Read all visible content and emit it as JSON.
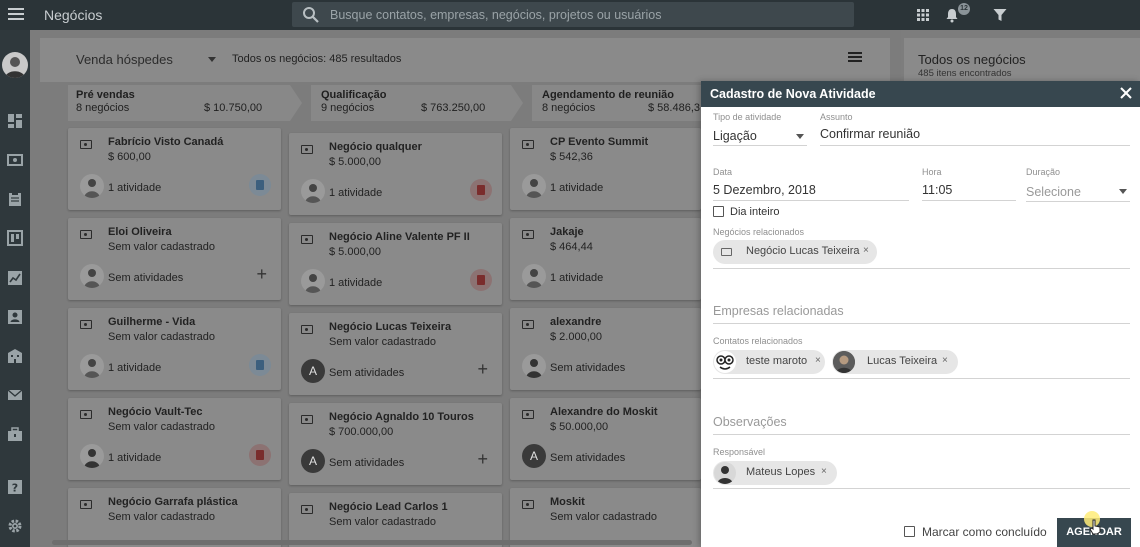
{
  "topbar": {
    "app_title": "Negócios",
    "search_placeholder": "Busque contatos, empresas, negócios, projetos ou usuários",
    "notification_count": "12"
  },
  "board": {
    "pipeline": "Venda hóspedes",
    "results": "Todos os negócios: 485 resultados",
    "stages": [
      {
        "name": "Pré vendas",
        "count": "8 negócios",
        "total": "$ 10.750,00"
      },
      {
        "name": "Qualificação",
        "count": "9 negócios",
        "total": "$ 763.250,00"
      },
      {
        "name": "Agendamento de reunião",
        "count": "8 negócios",
        "total": "$ 58.486,3"
      }
    ],
    "columns": [
      [
        {
          "title": "Fabrício Visto Canadá",
          "value": "$ 600,00",
          "activity": "1 atividade"
        },
        {
          "title": "Eloi Oliveira",
          "value": "Sem valor cadastrado",
          "activity": "Sem atividades"
        },
        {
          "title": "Guilherme - Vida",
          "value": "Sem valor cadastrado",
          "activity": "1 atividade"
        },
        {
          "title": "Negócio Vault-Tec",
          "value": "Sem valor cadastrado",
          "activity": "1 atividade"
        },
        {
          "title": "Negócio Garrafa plástica",
          "value": "Sem valor cadastrado",
          "activity": ""
        }
      ],
      [
        {
          "title": "Negócio qualquer",
          "value": "$ 5.000,00",
          "activity": "1 atividade"
        },
        {
          "title": "Negócio Aline Valente PF II",
          "value": "$ 5.000,00",
          "activity": "1 atividade"
        },
        {
          "title": "Negócio Lucas Teixeira",
          "value": "Sem valor cadastrado",
          "activity": "Sem atividades"
        },
        {
          "title": "Negócio Agnaldo 10 Touros",
          "value": "$ 700.000,00",
          "activity": "Sem atividades"
        },
        {
          "title": "Negócio Lead Carlos 1",
          "value": "Sem valor cadastrado",
          "activity": ""
        }
      ],
      [
        {
          "title": "CP Evento Summit",
          "value": "$ 542,36",
          "activity": "1 atividade"
        },
        {
          "title": "Jakaje",
          "value": "$ 464,44",
          "activity": "1 atividade"
        },
        {
          "title": "alexandre",
          "value": "$ 2.000,00",
          "activity": "Sem atividades"
        },
        {
          "title": "Alexandre do Moskit",
          "value": "$ 50.000,00",
          "activity": "Sem atividades"
        },
        {
          "title": "Moskit",
          "value": "Sem valor cadastrado",
          "activity": ""
        }
      ]
    ],
    "avatar_letter": "A"
  },
  "right_panel": {
    "title": "Todos os negócios",
    "subtitle": "485 itens encontrados"
  },
  "modal": {
    "title": "Cadastro de Nova Atividade",
    "activity_type_label": "Tipo de atividade",
    "activity_type_value": "Ligação",
    "subject_label": "Assunto",
    "subject_value": "Confirmar reunião",
    "date_label": "Data",
    "date_value": "5 Dezembro, 2018",
    "time_label": "Hora",
    "time_value": "11:05",
    "duration_label": "Duração",
    "duration_placeholder": "Selecione",
    "all_day_label": "Dia inteiro",
    "related_deals_label": "Negócios relacionados",
    "related_deal_chip": "Negócio Lucas Teixeira",
    "related_companies_placeholder": "Empresas relacionadas",
    "related_contacts_label": "Contatos relacionados",
    "contacts": [
      "teste maroto",
      "Lucas Teixeira"
    ],
    "notes_placeholder": "Observações",
    "responsible_label": "Responsável",
    "responsible_chip": "Mateus Lopes",
    "mark_done_label": "Marcar como concluído",
    "schedule_button": "AGENDAR",
    "chip_close": "×"
  },
  "colors": {
    "topbar": "#2b3438",
    "modal_header": "#37474f",
    "chip": "#e6e6e6"
  }
}
